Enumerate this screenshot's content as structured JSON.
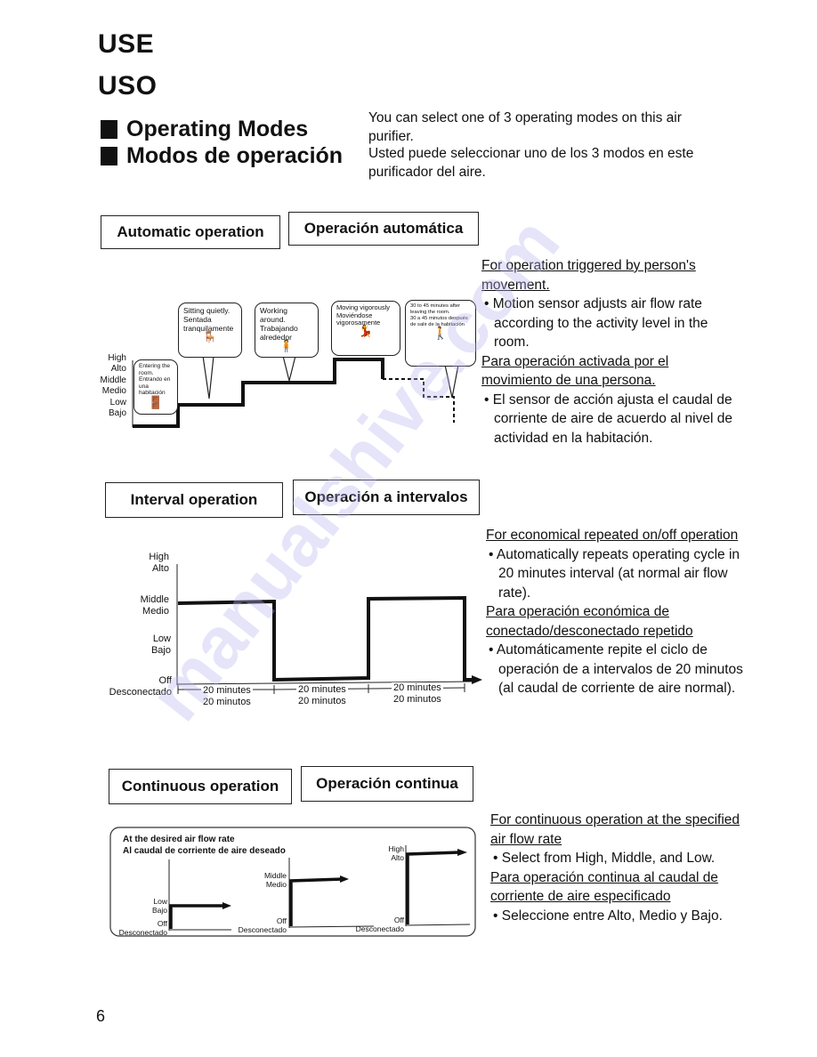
{
  "page": {
    "heading_en": "USE",
    "heading_es": "USO",
    "section_en": "Operating Modes",
    "section_es": "Modos de operación",
    "intro_en": "You can select one of 3 operating modes on this air purifier.",
    "intro_es": "Usted puede seleccionar uno de los 3 modos en este purificador del aire.",
    "page_number": "6",
    "watermark": "manualshive.com"
  },
  "automatic": {
    "label_en": "Automatic operation",
    "label_es": "Operación automática",
    "levels": [
      {
        "en": "High",
        "es": "Alto"
      },
      {
        "en": "Middle",
        "es": "Medio"
      },
      {
        "en": "Low",
        "es": "Bajo"
      }
    ],
    "bubbles": [
      {
        "en": "Entering the room.",
        "es": "Entrando en una habitación",
        "icon": "person-door-icon"
      },
      {
        "en": "Sitting quietly.",
        "es": "Sentada tranquilamente",
        "icon": "person-sitting-icon"
      },
      {
        "en": "Working around.",
        "es": "Trabajando alrededor",
        "icon": "person-working-icon"
      },
      {
        "en": "Moving vigorously",
        "es": "Moviéndose vigorosamente",
        "icon": "person-dancing-icon"
      },
      {
        "en": "30 to 45 minutes after leaving the room.",
        "es": "30 a 45 minutos después de salir de la habitación",
        "icon": "person-leaving-icon"
      }
    ],
    "heading_en": "For operation triggered by person's movement.",
    "bullet_en": "Motion sensor adjusts air flow rate according to the activity level in the room.",
    "heading_es": "Para operación activada por el movimiento de una persona.",
    "bullet_es": "El sensor de acción ajusta el caudal de corriente de aire de acuerdo al nivel de actividad en la habitación."
  },
  "interval": {
    "label_en": "Interval operation",
    "label_es": "Operación a intervalos",
    "levels": [
      {
        "en": "High",
        "es": "Alto"
      },
      {
        "en": "Middle",
        "es": "Medio"
      },
      {
        "en": "Low",
        "es": "Bajo"
      },
      {
        "en": "Off",
        "es": "Desconectado"
      }
    ],
    "durations": [
      {
        "en": "20 minutes",
        "es": "20 minutos"
      },
      {
        "en": "20 minutes",
        "es": "20 minutos"
      },
      {
        "en": "20 minutes",
        "es": "20 minutos"
      }
    ],
    "heading_en": "For economical repeated on/off operation",
    "bullet_en": "Automatically repeats operating cycle in 20 minutes interval (at normal air flow rate).",
    "heading_es": "Para operación económica de conectado/desconectado repetido",
    "bullet_es": "Automáticamente repite el ciclo de operación de a intervalos de 20 minutos (al caudal de corriente de aire normal)."
  },
  "continuous": {
    "label_en": "Continuous operation",
    "label_es": "Operación continua",
    "box_title_en": "At the desired air flow rate",
    "box_title_es": "Al caudal de corriente de aire deseado",
    "charts": [
      {
        "level_en": "Low",
        "level_es": "Bajo",
        "off_en": "Off",
        "off_es": "Desconectado"
      },
      {
        "level_en": "Middle",
        "level_es": "Medio",
        "off_en": "Off",
        "off_es": "Desconectado"
      },
      {
        "level_en": "High",
        "level_es": "Alto",
        "off_en": "Off",
        "off_es": "Desconectado"
      }
    ],
    "heading_en": "For continuous operation at the specified air flow rate",
    "bullet_en": "Select from High, Middle, and Low.",
    "heading_es": "Para operación continua al caudal de corriente de aire especificado",
    "bullet_es": "Seleccione entre Alto, Medio y Bajo."
  }
}
